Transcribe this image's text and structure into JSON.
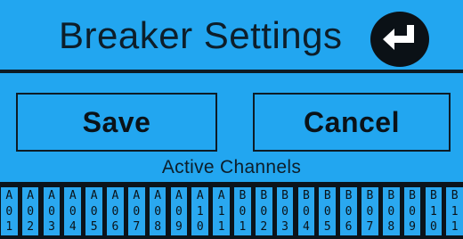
{
  "header": {
    "title": "Breaker Settings"
  },
  "buttons": {
    "save_label": "Save",
    "cancel_label": "Cancel"
  },
  "section": {
    "label": "Active Channels"
  },
  "channels": [
    [
      "A",
      "0",
      "1"
    ],
    [
      "A",
      "0",
      "2"
    ],
    [
      "A",
      "0",
      "3"
    ],
    [
      "A",
      "0",
      "4"
    ],
    [
      "A",
      "0",
      "5"
    ],
    [
      "A",
      "0",
      "6"
    ],
    [
      "A",
      "0",
      "7"
    ],
    [
      "A",
      "0",
      "8"
    ],
    [
      "A",
      "0",
      "9"
    ],
    [
      "A",
      "1",
      "0"
    ],
    [
      "A",
      "1",
      "1"
    ],
    [
      "B",
      "0",
      "1"
    ],
    [
      "B",
      "0",
      "2"
    ],
    [
      "B",
      "0",
      "3"
    ],
    [
      "B",
      "0",
      "4"
    ],
    [
      "B",
      "0",
      "5"
    ],
    [
      "B",
      "0",
      "6"
    ],
    [
      "B",
      "0",
      "7"
    ],
    [
      "B",
      "0",
      "8"
    ],
    [
      "B",
      "0",
      "9"
    ],
    [
      "B",
      "1",
      "0"
    ],
    [
      "B",
      "1",
      "1"
    ]
  ],
  "icons": {
    "back": "return-arrow-icon"
  },
  "colors": {
    "background": "#22a6f0",
    "foreground": "#0d1c26"
  }
}
